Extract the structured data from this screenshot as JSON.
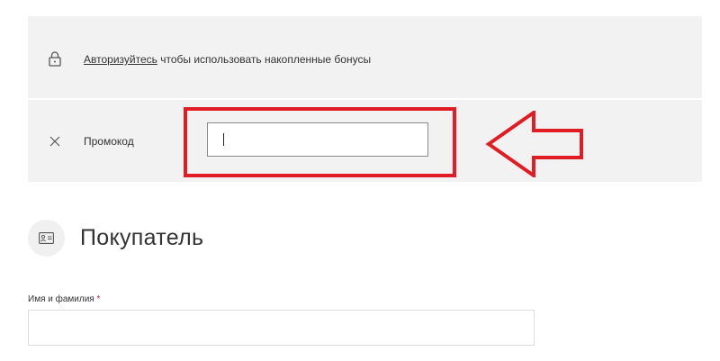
{
  "bonus": {
    "link_text": "Авторизуйтесь",
    "text": " чтобы использовать накопленные бонусы"
  },
  "promo": {
    "label": "Промокод",
    "value": ""
  },
  "buyer": {
    "title": "Покупатель",
    "name_label": "Имя и фамилия",
    "required_mark": "*",
    "name_value": ""
  },
  "annotation": {
    "color": "#e01c24"
  },
  "icons": [
    "lock-icon",
    "close-icon",
    "id-card-icon",
    "arrow-left-icon"
  ]
}
